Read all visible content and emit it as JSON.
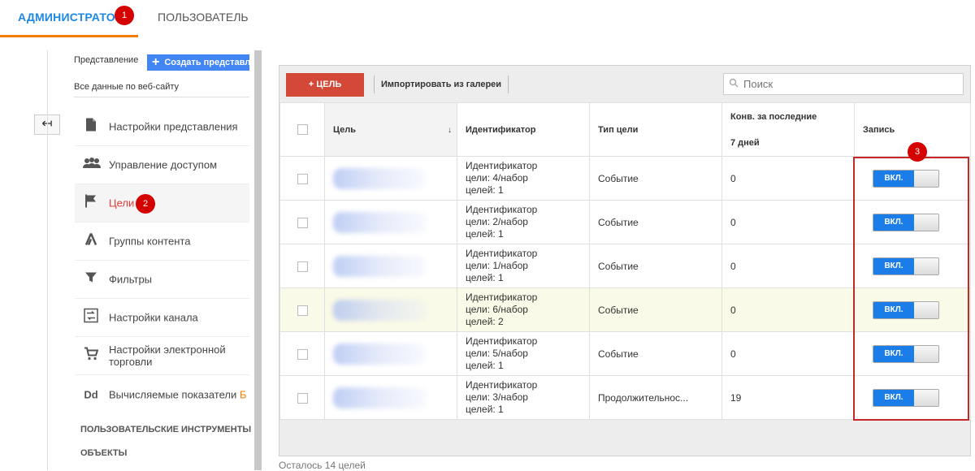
{
  "tabs": {
    "admin": "АДМИНИСТРАТОР",
    "user": "ПОЛЬЗОВАТЕЛЬ"
  },
  "badges": {
    "b1": "1",
    "b2": "2",
    "b3": "3"
  },
  "view": {
    "label": "Представление",
    "create_button": "Создать представление",
    "name": "Все данные по веб-сайту",
    "back_icon": "back-arrow-icon"
  },
  "menu": [
    {
      "label": "Настройки представления",
      "icon": "document-icon",
      "glyph": "▇"
    },
    {
      "label": "Управление доступом",
      "icon": "users-icon",
      "glyph": "👥"
    },
    {
      "label": "Цели",
      "icon": "flag-icon",
      "glyph": "⚑"
    },
    {
      "label": "Группы контента",
      "icon": "content-groups-icon",
      "glyph": "⅄"
    },
    {
      "label": "Фильтры",
      "icon": "filter-icon",
      "glyph": "▼"
    },
    {
      "label": "Настройки канала",
      "icon": "channel-settings-icon",
      "glyph": "⇄"
    },
    {
      "label": "Настройки электронной торговли",
      "icon": "cart-icon",
      "glyph": "🛒"
    },
    {
      "label": "Вычисляемые показатели",
      "extra": "Б",
      "icon": "calculated-metrics-icon",
      "glyph": "Dd"
    }
  ],
  "sections": {
    "tools": "ПОЛЬЗОВАТЕЛЬСКИЕ ИНСТРУМЕНТЫ И",
    "objects": "ОБЪЕКТЫ"
  },
  "toolbar": {
    "add_label": "+ ЦЕЛЬ",
    "import_label": "Импортировать из галереи",
    "search_placeholder": "Поиск"
  },
  "table": {
    "headers": {
      "goal": "Цель",
      "id": "Идентификатор",
      "type": "Тип цели",
      "conv_line1": "Конв. за последние",
      "conv_line2": "7 дней",
      "record": "Запись"
    },
    "rows": [
      {
        "id_l1": "Идентификатор",
        "id_l2": "цели: 4/набор",
        "id_l3": "целей: 1",
        "type": "Событие",
        "conv": "0",
        "toggle": "ВКЛ."
      },
      {
        "id_l1": "Идентификатор",
        "id_l2": "цели: 2/набор",
        "id_l3": "целей: 1",
        "type": "Событие",
        "conv": "0",
        "toggle": "ВКЛ."
      },
      {
        "id_l1": "Идентификатор",
        "id_l2": "цели: 1/набор",
        "id_l3": "целей: 1",
        "type": "Событие",
        "conv": "0",
        "toggle": "ВКЛ."
      },
      {
        "id_l1": "Идентификатор",
        "id_l2": "цели: 6/набор",
        "id_l3": "целей: 2",
        "type": "Событие",
        "conv": "0",
        "toggle": "ВКЛ."
      },
      {
        "id_l1": "Идентификатор",
        "id_l2": "цели: 5/набор",
        "id_l3": "целей: 1",
        "type": "Событие",
        "conv": "0",
        "toggle": "ВКЛ."
      },
      {
        "id_l1": "Идентификатор",
        "id_l2": "цели: 3/набор",
        "id_l3": "целей: 1",
        "type": "Продолжительнос...",
        "conv": "19",
        "toggle": "ВКЛ."
      }
    ]
  },
  "footer": "Осталось 14 целей",
  "colors": {
    "accent_blue": "#1e88e5",
    "tab_underline": "#f57c00",
    "add_button": "#d34836",
    "toggle_on": "#1a7de8",
    "badge_red": "#d50000",
    "highlight_row": "#fafae8"
  }
}
